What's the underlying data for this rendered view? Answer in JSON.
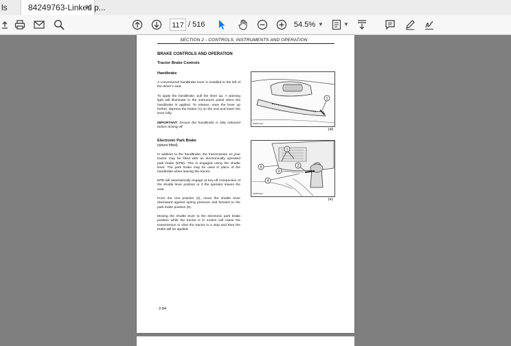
{
  "tabs": [
    {
      "label": "ls",
      "active": false
    },
    {
      "label": "84249763-Linked p...",
      "active": true
    }
  ],
  "toolbar": {
    "page_current": "117",
    "page_separator": "/",
    "page_total": "516",
    "zoom": "54.5%"
  },
  "document": {
    "header": "SECTION 2  -  CONTROLS, INSTRUMENTS AND OPERATION",
    "heading_main": "BRAKE CONTROLS AND OPERATION",
    "heading_sub": "Tractor Brake Controls",
    "handbrake": {
      "title": "Handbrake",
      "p1": "A conventional handbrake lever is installed to the left of the driver's seat.",
      "p2": "To apply the handbrake, pull the lever up. A warning light will illuminate in the instrument panel when the handbrake is applied. To release, ease the lever up further, depress the button (1) on the end and lower the lever fully.",
      "important_label": "IMPORTANT:",
      "important_text": "Ensure the handbrake is fully released before driving off.",
      "figure_number": "140",
      "figure_code": "MSB4101A"
    },
    "epb": {
      "title": "Electronic Park Brake",
      "subtitle": "(where fitted)",
      "p1": "In addition to the handbrake, the transmission on your tractor may be fitted with an electronically operated park brake (EPB). This is engaged using the shuttle lever. The park brake may be used in place of the handbrake when leaving the tractor.",
      "p2": "EPB will automatically engage at key-off irrespective of the shuttle lever position or if the operator leaves the seat.",
      "p3": "From the rest position (3), move the shuttle lever downward against spring pressure and forward to the park brake position (5).",
      "p4": "Moving the shuttle lever to the electronic park brake position while the tractor is in motion will cause the transmission to slow the tractor to a stop and then the brake will be applied.",
      "figure_number": "141",
      "figure_code": "MSB9940A",
      "callouts": [
        "1",
        "2",
        "3",
        "4",
        "5"
      ]
    },
    "page_number": "2-84"
  },
  "colors": {
    "background": "#7f7f7f",
    "toolbar": "#f7f7f7",
    "accent": "#1a73e8"
  }
}
